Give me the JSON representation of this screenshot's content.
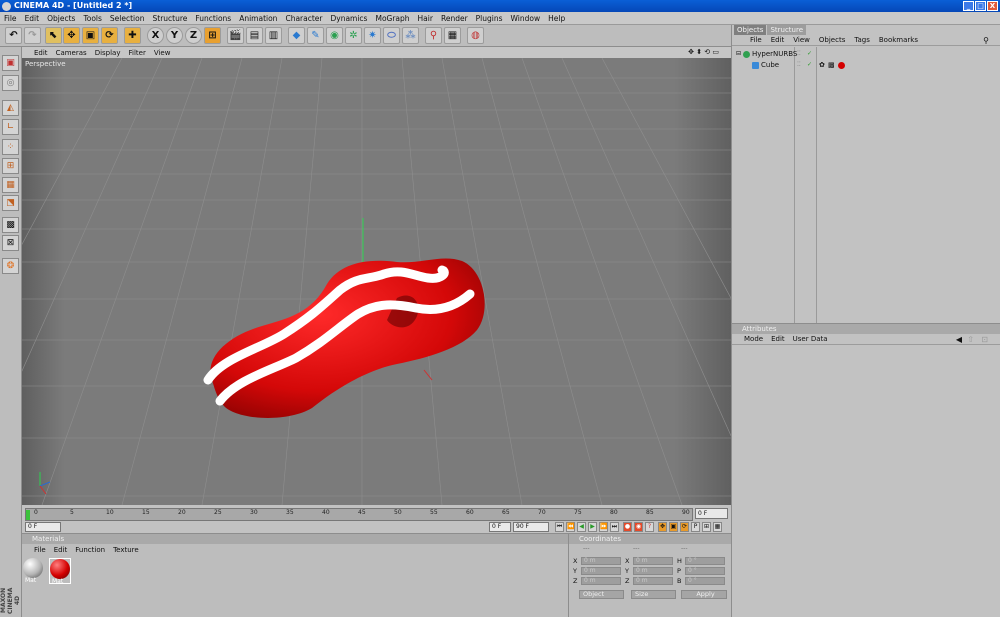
{
  "window": {
    "title": "CINEMA 4D - [Untitled 2 *]",
    "controls": [
      "_",
      "□",
      "X"
    ]
  },
  "menubar": [
    "File",
    "Edit",
    "Objects",
    "Tools",
    "Selection",
    "Structure",
    "Functions",
    "Animation",
    "Character",
    "Dynamics",
    "MoGraph",
    "Hair",
    "Render",
    "Plugins",
    "Window",
    "Help"
  ],
  "toolbar": {
    "axis_x": "X",
    "axis_y": "Y",
    "axis_z": "Z"
  },
  "viewport": {
    "menu": [
      "Edit",
      "Cameras",
      "Display",
      "Filter",
      "View"
    ],
    "label": "Perspective",
    "nav_icons": "✥ ⬍ ⟲ ▭"
  },
  "timeline": {
    "ticks": [
      "0",
      "5",
      "10",
      "15",
      "20",
      "25",
      "30",
      "35",
      "40",
      "45",
      "50",
      "55",
      "60",
      "65",
      "70",
      "75",
      "80",
      "85",
      "90"
    ],
    "end_frame": "0 F",
    "current_frame": "0 F",
    "min_frame": "0 F",
    "max_frame": "90 F"
  },
  "materials": {
    "title": "Materials",
    "menu": [
      "File",
      "Edit",
      "Function",
      "Texture"
    ],
    "items": [
      {
        "label": "Mat",
        "color": "#d9d9d9"
      },
      {
        "label": "Mat",
        "color": "#d40000"
      }
    ]
  },
  "coordinates": {
    "title": "Coordinates",
    "col_headers": [
      "---",
      "---",
      "---"
    ],
    "rows": [
      {
        "a": "X",
        "av": "0 m",
        "b": "X",
        "bv": "0 m",
        "c": "H",
        "cv": "0 °"
      },
      {
        "a": "Y",
        "av": "0 m",
        "b": "Y",
        "bv": "0 m",
        "c": "P",
        "cv": "0 °"
      },
      {
        "a": "Z",
        "av": "0 m",
        "b": "Z",
        "bv": "0 m",
        "c": "B",
        "cv": "0 °"
      }
    ],
    "mode": "Object",
    "size_mode": "Size",
    "apply": "Apply"
  },
  "objects": {
    "tabs": [
      "Objects",
      "Structure"
    ],
    "menu": [
      "File",
      "Edit",
      "View",
      "Objects",
      "Tags",
      "Bookmarks"
    ],
    "items": [
      {
        "name": "HyperNURBS",
        "indent": 0
      },
      {
        "name": "Cube",
        "indent": 1
      }
    ]
  },
  "attributes": {
    "title": "Attributes",
    "menu": [
      "Mode",
      "Edit",
      "User Data"
    ]
  },
  "side_brand": "MAXON CINEMA 4D",
  "colors": {
    "title_blue": "#0a5fd6",
    "object_red": "#e01212",
    "stripe_white": "#ffffff",
    "viewport_bg": "#7b7b7b"
  }
}
